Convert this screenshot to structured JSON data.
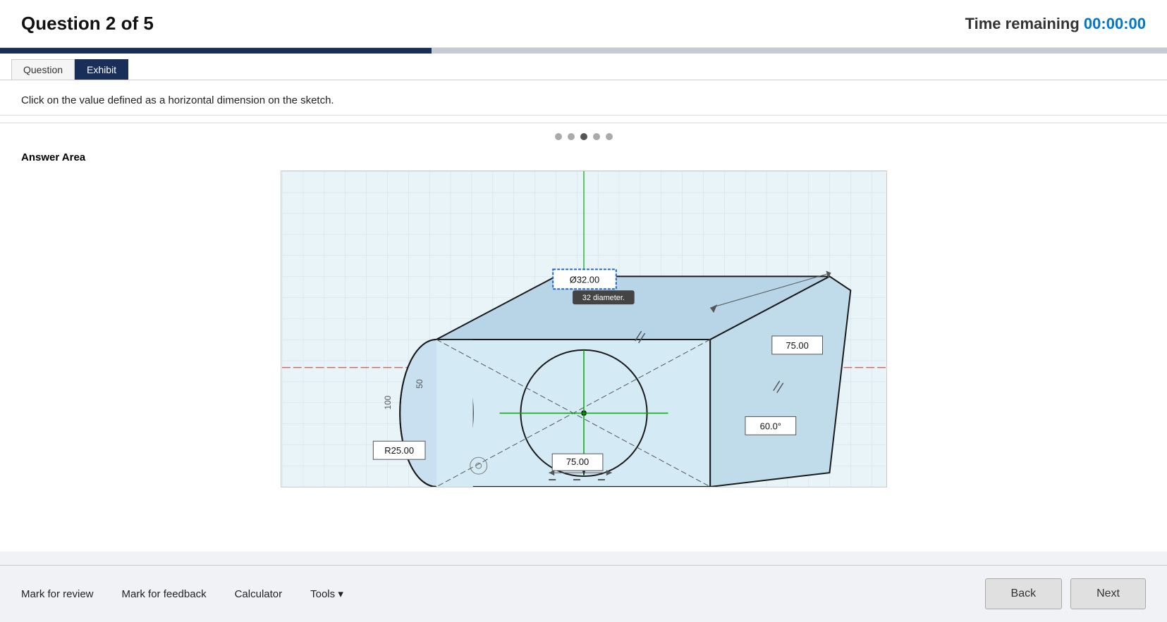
{
  "header": {
    "title": "Question 2 of 5",
    "time_label": "Time remaining",
    "time_value": "00:00:00"
  },
  "progress": {
    "percent": 37
  },
  "tabs": [
    {
      "label": "Question",
      "active": false
    },
    {
      "label": "Exhibit",
      "active": true
    }
  ],
  "question": {
    "text": "Click on the value defined as a horizontal dimension on the sketch."
  },
  "dots": [
    {
      "active": false
    },
    {
      "active": false
    },
    {
      "active": true
    },
    {
      "active": false
    },
    {
      "active": false
    }
  ],
  "answer_area": {
    "label": "Answer Area"
  },
  "sketch": {
    "dimensions": {
      "diameter": "Ø32.00",
      "radius": "R25.00",
      "angle": "60.0°",
      "length75_top": "75.00",
      "length75_bottom": "75.00",
      "length50": "50",
      "length100": "100"
    },
    "tooltip": "32 diameter."
  },
  "footer": {
    "mark_review": "Mark for review",
    "mark_feedback": "Mark for feedback",
    "calculator": "Calculator",
    "tools": "Tools",
    "back": "Back",
    "next": "Next"
  }
}
